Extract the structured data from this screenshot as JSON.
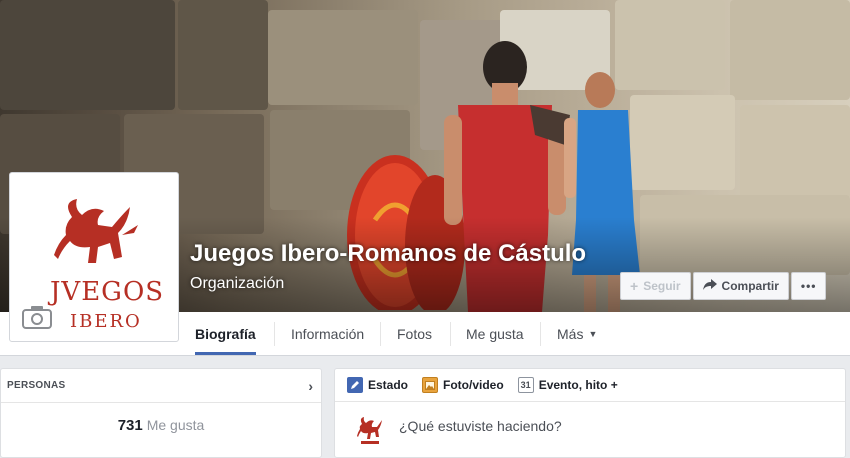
{
  "page": {
    "name": "Juegos Ibero-Romanos de Cástulo",
    "category": "Organización",
    "logo_text_line1": "JVEGOS",
    "logo_text_line2": "IBERO"
  },
  "actions": {
    "follow_label": "Seguir",
    "share_label": "Compartir",
    "more_label": "•••"
  },
  "tabs": [
    {
      "label": "Biografía",
      "active": true
    },
    {
      "label": "Información"
    },
    {
      "label": "Fotos"
    },
    {
      "label": "Me gusta"
    },
    {
      "label": "Más"
    }
  ],
  "people_card": {
    "title": "PERSONAS",
    "likes_count": "731",
    "likes_label": "Me gusta"
  },
  "composer": {
    "tabs": [
      {
        "label": "Estado",
        "icon": "pencil-icon"
      },
      {
        "label": "Foto/video",
        "icon": "photo-icon"
      },
      {
        "label": "Evento, hito +",
        "icon": "calendar-icon",
        "icon_text": "31"
      }
    ],
    "placeholder": "¿Qué estuviste haciendo?"
  },
  "colors": {
    "accent": "#4267b2",
    "brand_red": "#b62f24",
    "tunic_red": "#c62f2f",
    "tunic_blue": "#2a7fd0"
  }
}
